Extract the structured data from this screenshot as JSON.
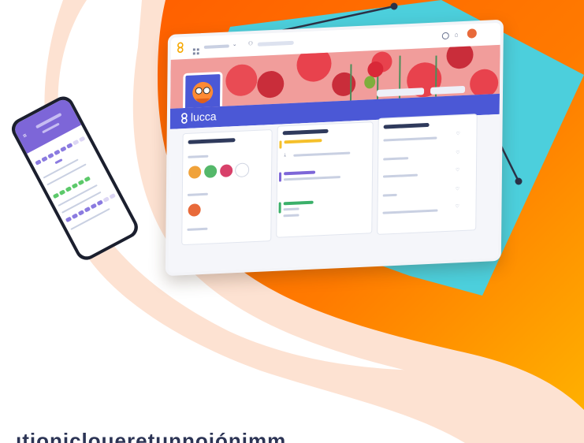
{
  "brand": {
    "name": "lucca",
    "icon": "lucca-logo-icon",
    "colors": {
      "brand_blue": "#4b58d6",
      "orange": "#ff6a00",
      "amber": "#ffaa00",
      "teal": "#4ccfdc",
      "peach": "#fde2d2",
      "poppy_red": "#e8424d",
      "calendar_purple": "#8b7be0",
      "calendar_green": "#5cc96a"
    }
  },
  "headline_fragment": "ıtionicloueretunnoiónimm"
}
